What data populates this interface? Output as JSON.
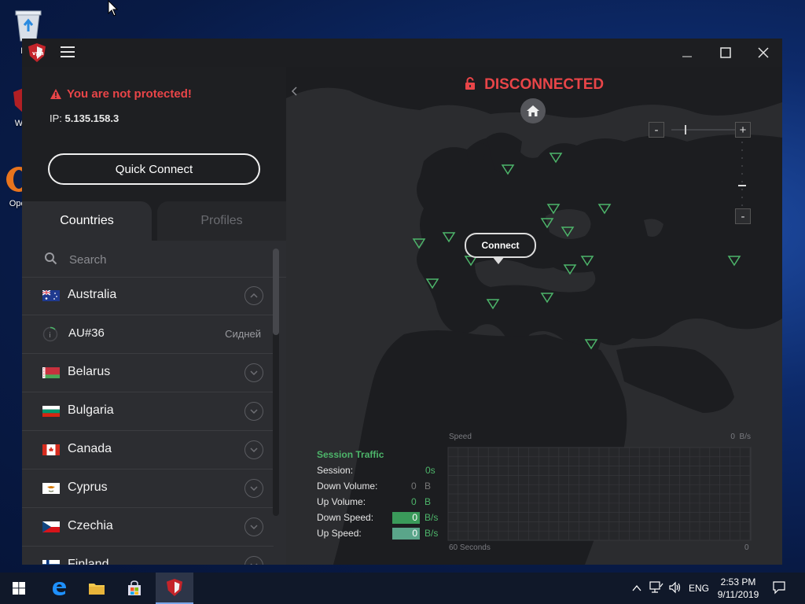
{
  "desktop": {
    "icons": [
      {
        "label": "Rec"
      },
      {
        "label": "Web"
      },
      {
        "label": "Oper"
      }
    ]
  },
  "app": {
    "status_warning": "You are not protected!",
    "ip_label": "IP:",
    "ip_value": "5.135.158.3",
    "quick_connect_label": "Quick Connect",
    "tabs": {
      "countries": "Countries",
      "profiles": "Profiles"
    },
    "search_placeholder": "Search",
    "countries": [
      {
        "name": "Australia",
        "expanded": true
      },
      {
        "name": "Belarus"
      },
      {
        "name": "Bulgaria"
      },
      {
        "name": "Canada"
      },
      {
        "name": "Cyprus"
      },
      {
        "name": "Czechia"
      },
      {
        "name": "Finland"
      }
    ],
    "servers": [
      {
        "name": "AU#36",
        "city": "Сидней"
      }
    ],
    "connection_status": "DISCONNECTED",
    "connect_label": "Connect",
    "accent_red": "#e94548",
    "accent_green": "#4db56a"
  },
  "session": {
    "title": "Session Traffic",
    "session_label": "Session:",
    "session_value": "0s",
    "down_volume_label": "Down Volume:",
    "down_volume_value": "0",
    "down_volume_unit": "B",
    "up_volume_label": "Up Volume:",
    "up_volume_value": "0",
    "up_volume_unit": "B",
    "down_speed_label": "Down Speed:",
    "down_speed_value": "0",
    "down_speed_unit": "B/s",
    "up_speed_label": "Up Speed:",
    "up_speed_value": "0",
    "up_speed_unit": "B/s"
  },
  "graph": {
    "speed_label": "Speed",
    "max_label": "0  B/s",
    "time_label": "60 Seconds",
    "zero_label": "0"
  },
  "taskbar": {
    "time": "2:53 PM",
    "date": "9/11/2019",
    "lang": "ENG"
  }
}
